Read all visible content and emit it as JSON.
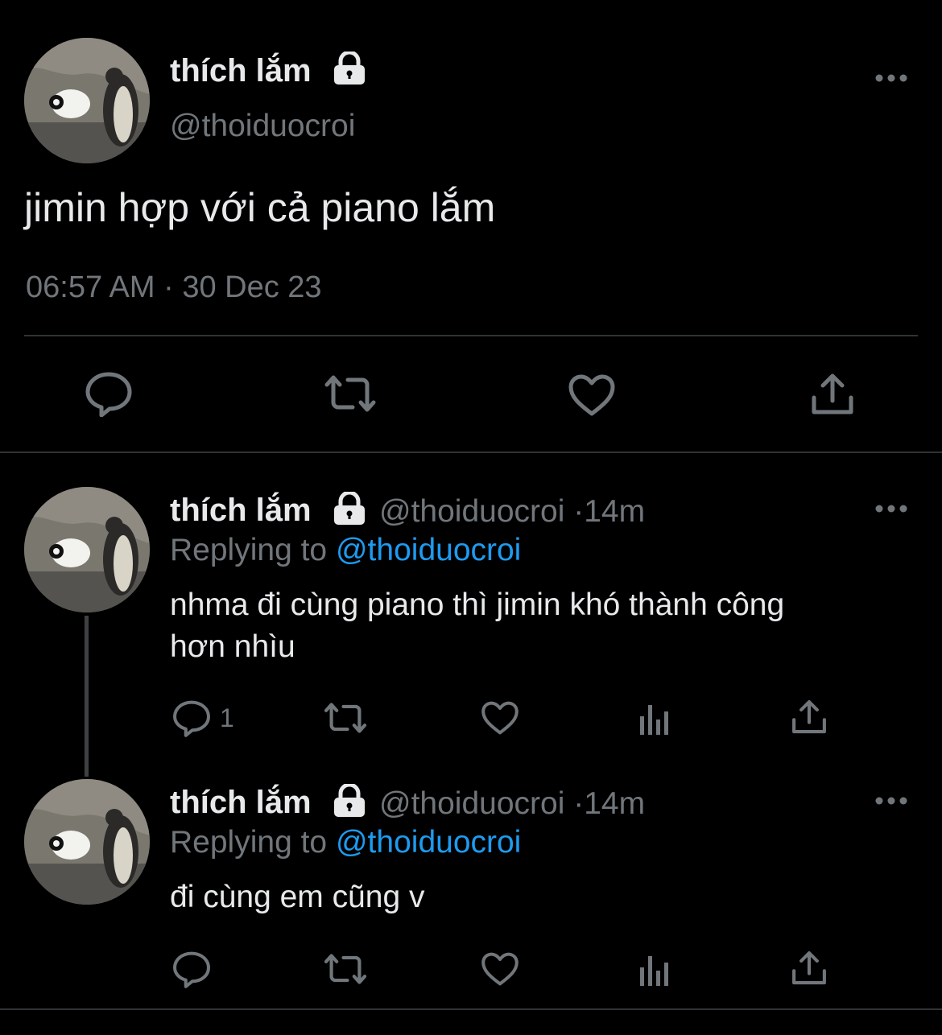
{
  "main_tweet": {
    "display_name": "thích lắm",
    "handle": "@thoiduocroi",
    "text": "jimin hợp với cả piano lắm",
    "time": "06:57 AM",
    "separator": "·",
    "date": "30 Dec 23"
  },
  "replies": [
    {
      "display_name": "thích lắm",
      "handle": "@thoiduocroi",
      "separator": "·",
      "age": "14m",
      "replying_prefix": "Replying to",
      "replying_handle": "@thoiduocroi",
      "text_line1": "nhma đi cùng piano thì jimin khó thành công",
      "text_line2": "hơn nhìu",
      "reply_count": "1"
    },
    {
      "display_name": "thích lắm",
      "handle": "@thoiduocroi",
      "separator": "·",
      "age": "14m",
      "replying_prefix": "Replying to",
      "replying_handle": "@thoiduocroi",
      "text_line1": "đi cùng em cũng v",
      "text_line2": "",
      "reply_count": ""
    }
  ],
  "colors": {
    "background": "#000000",
    "text": "#e7e9ea",
    "muted": "#71767b",
    "link": "#1d9bf0",
    "divider": "#2f3336"
  },
  "icons": [
    "lock-icon",
    "more-icon",
    "reply-icon",
    "retweet-icon",
    "like-icon",
    "share-icon",
    "analytics-icon"
  ]
}
